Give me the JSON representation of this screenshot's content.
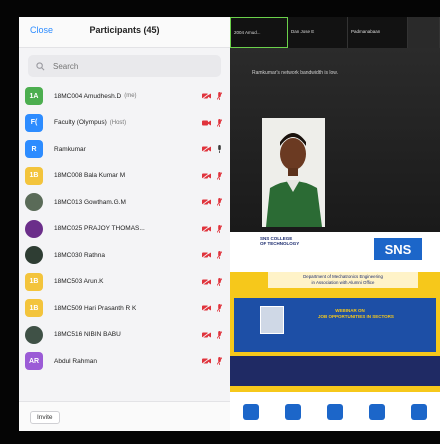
{
  "panel": {
    "close_label": "Close",
    "title": "Participants (45)",
    "search_placeholder": "Search",
    "invite_label": "Invite",
    "participants": [
      {
        "initials": "1A",
        "avatar_color": "#4cae4f",
        "photo": false,
        "name": "18MC004 Amudhesh.D",
        "role": "(me)",
        "cam_off": true,
        "mic_muted": true
      },
      {
        "initials": "F(",
        "avatar_color": "#2d8cff",
        "photo": false,
        "name": "Faculty (Olympus)",
        "role": "(Host)",
        "cam_off": false,
        "mic_muted": true
      },
      {
        "initials": "R",
        "avatar_color": "#2d8cff",
        "photo": false,
        "name": "Ramkumar",
        "role": "",
        "cam_off": true,
        "mic_muted": false
      },
      {
        "initials": "1B",
        "avatar_color": "#f3c43c",
        "photo": false,
        "name": "18MC008 Bala Kumar M",
        "role": "",
        "cam_off": true,
        "mic_muted": true
      },
      {
        "initials": "",
        "avatar_color": "#5a6b58",
        "photo": true,
        "name": "18MC013 Gowtham.G.M",
        "role": "",
        "cam_off": true,
        "mic_muted": true
      },
      {
        "initials": "",
        "avatar_color": "#6b2e8a",
        "photo": true,
        "name": "18MC025 PRAJOY THOMAS...",
        "role": "",
        "cam_off": true,
        "mic_muted": true
      },
      {
        "initials": "",
        "avatar_color": "#2e3d33",
        "photo": true,
        "name": "18MC030 Rathna",
        "role": "",
        "cam_off": true,
        "mic_muted": true
      },
      {
        "initials": "1B",
        "avatar_color": "#f3c43c",
        "photo": false,
        "name": "18MC503 Arun.K",
        "role": "",
        "cam_off": true,
        "mic_muted": true
      },
      {
        "initials": "1B",
        "avatar_color": "#f3c43c",
        "photo": false,
        "name": "18MC509 Hari Prasanth R K",
        "role": "",
        "cam_off": true,
        "mic_muted": true
      },
      {
        "initials": "",
        "avatar_color": "#3f5146",
        "photo": true,
        "name": "18MC516 NIBIN BABU",
        "role": "",
        "cam_off": true,
        "mic_muted": true
      },
      {
        "initials": "AR",
        "avatar_color": "#9b5bd6",
        "photo": false,
        "name": "Abdul Rahman",
        "role": "",
        "cam_off": true,
        "mic_muted": true
      }
    ]
  },
  "gallery": {
    "thumbs": [
      "2004 Amud...",
      "Dan Jose E",
      "Padmanabaan"
    ],
    "network_notice": "Ramkumar's network bandwidth is low."
  },
  "slide": {
    "college": "SNS COLLEGE\nOF TECHNOLOGY",
    "logo_text": "SNS",
    "department": "Department of Mechatronics Engineering\nin Association with Alumni Office",
    "webinar": "WEBINAR ON\nJOB OPPORTUNITIES IN SECTORS"
  },
  "colors": {
    "accent": "#2d8cff",
    "muted_red": "#e0333c",
    "slide_yellow": "#f6c81b"
  }
}
